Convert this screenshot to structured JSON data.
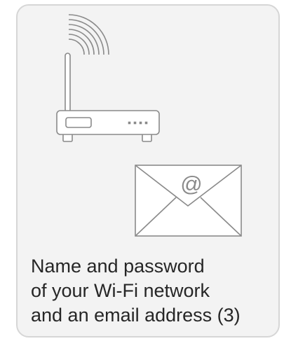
{
  "card": {
    "icons": [
      "wifi-signal-icon",
      "router-icon",
      "email-envelope-icon"
    ],
    "email_symbol": "@",
    "caption_lines": [
      "Name and password",
      "of your Wi-Fi network",
      "and an email address (3)"
    ]
  },
  "colors": {
    "card_background": "#f3f3f3",
    "card_border": "#d6d6d6",
    "line_art": "#8a8a8a",
    "text": "#262626"
  }
}
